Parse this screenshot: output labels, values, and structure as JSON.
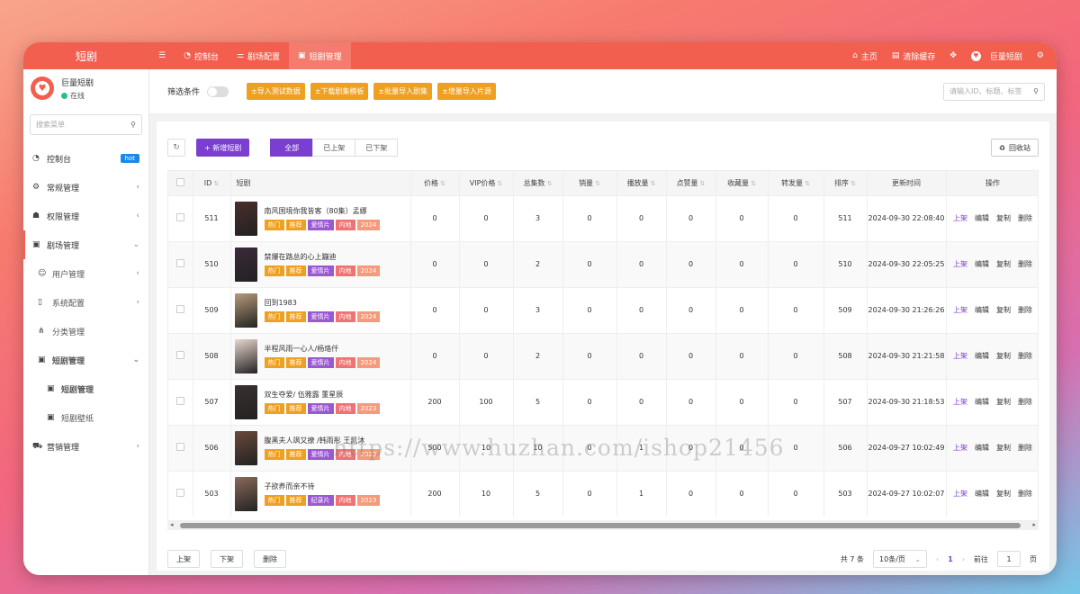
{
  "brand": "短剧",
  "top_nav": [
    {
      "icon": "menu-icon",
      "label": ""
    },
    {
      "icon": "dashboard-icon",
      "label": "控制台"
    },
    {
      "icon": "sliders-icon",
      "label": "剧场配置"
    },
    {
      "icon": "bag-icon",
      "label": "短剧管理"
    }
  ],
  "top_right": {
    "home": "主页",
    "clear_cache": "清除缓存",
    "user": "巨量短剧"
  },
  "sidebar": {
    "username": "巨量短剧",
    "status": "在线",
    "search_placeholder": "搜索菜单",
    "items": [
      {
        "label": "控制台",
        "badge": "hot"
      },
      {
        "label": "常规管理"
      },
      {
        "label": "权限管理"
      },
      {
        "label": "剧场管理"
      },
      {
        "label": "用户管理"
      },
      {
        "label": "系统配置"
      },
      {
        "label": "分类管理"
      },
      {
        "label": "短剧管理"
      },
      {
        "label": "短剧管理"
      },
      {
        "label": "短剧壁纸"
      },
      {
        "label": "营销管理"
      }
    ]
  },
  "filter": {
    "label": "筛选条件",
    "buttons": [
      "±导入测试数据",
      "±下载剧集模板",
      "±批量导入剧集",
      "±增量导入片源"
    ],
    "search_placeholder": "请输入ID、标题、标签"
  },
  "toolbar": {
    "add": "+ 新增短剧",
    "tabs": [
      "全部",
      "已上架",
      "已下架"
    ],
    "recycle": "回收站"
  },
  "table": {
    "headers": [
      "ID",
      "短剧",
      "价格",
      "VIP价格",
      "总集数",
      "销量",
      "播放量",
      "点赞量",
      "收藏量",
      "转发量",
      "排序",
      "更新时间",
      "操作"
    ],
    "rows": [
      {
        "id": "511",
        "title": "南风国境你我皆客（80集）孟娜",
        "tags": [
          "热门",
          "推荐",
          "爱情片",
          "内地",
          "2024"
        ],
        "price": "0",
        "vip": "0",
        "total": "3",
        "sales": "0",
        "plays": "0",
        "likes": "0",
        "favs": "0",
        "shares": "0",
        "sort": "511",
        "updated": "2024-09-30 22:08:40"
      },
      {
        "id": "510",
        "title": "禁爆在路总的心上蹦迪",
        "tags": [
          "热门",
          "推荐",
          "爱情片",
          "内地",
          "2024"
        ],
        "price": "0",
        "vip": "0",
        "total": "2",
        "sales": "0",
        "plays": "0",
        "likes": "0",
        "favs": "0",
        "shares": "0",
        "sort": "510",
        "updated": "2024-09-30 22:05:25"
      },
      {
        "id": "509",
        "title": "回到1983",
        "tags": [
          "热门",
          "推荐",
          "爱情片",
          "内地",
          "2024"
        ],
        "price": "0",
        "vip": "0",
        "total": "3",
        "sales": "0",
        "plays": "0",
        "likes": "0",
        "favs": "0",
        "shares": "0",
        "sort": "509",
        "updated": "2024-09-30 21:26:26"
      },
      {
        "id": "508",
        "title": "半程风雨一心人/杨珞仟",
        "tags": [
          "热门",
          "推荐",
          "爱情片",
          "内地",
          "2024"
        ],
        "price": "0",
        "vip": "0",
        "total": "2",
        "sales": "0",
        "plays": "0",
        "likes": "0",
        "favs": "0",
        "shares": "0",
        "sort": "508",
        "updated": "2024-09-30 21:21:58"
      },
      {
        "id": "507",
        "title": "双生夺爱/ 伍雅露 董星辰",
        "tags": [
          "热门",
          "推荐",
          "爱情片",
          "内地",
          "2023"
        ],
        "price": "200",
        "vip": "100",
        "total": "5",
        "sales": "0",
        "plays": "0",
        "likes": "0",
        "favs": "0",
        "shares": "0",
        "sort": "507",
        "updated": "2024-09-30 21:18:53"
      },
      {
        "id": "506",
        "title": "腹黑夫人飒又撩 /韩雨彤 王凯沐",
        "tags": [
          "热门",
          "推荐",
          "爱情片",
          "内地",
          "2023"
        ],
        "price": "500",
        "vip": "10",
        "total": "10",
        "sales": "0",
        "plays": "1",
        "likes": "0",
        "favs": "0",
        "shares": "0",
        "sort": "506",
        "updated": "2024-09-27 10:02:49"
      },
      {
        "id": "503",
        "title": "子欲养而亲不待",
        "tags": [
          "热门",
          "推荐",
          "纪录片",
          "内地",
          "2023"
        ],
        "price": "200",
        "vip": "10",
        "total": "5",
        "sales": "0",
        "plays": "1",
        "likes": "0",
        "favs": "0",
        "shares": "0",
        "sort": "503",
        "updated": "2024-09-27 10:02:07"
      }
    ],
    "ops": [
      "上架",
      "编辑",
      "复制",
      "删除"
    ]
  },
  "bulk": [
    "上架",
    "下架",
    "删除"
  ],
  "pager": {
    "total": "共 7 条",
    "page_size": "10条/页",
    "current": "1",
    "goto_label": "前往",
    "goto_value": "1",
    "page_suffix": "页"
  },
  "watermark": "https://www.huzhan.com/ishop21456",
  "colors": {
    "accent": "#f25f4f",
    "primary": "#7a3fd0",
    "orange": "#f0a020"
  }
}
